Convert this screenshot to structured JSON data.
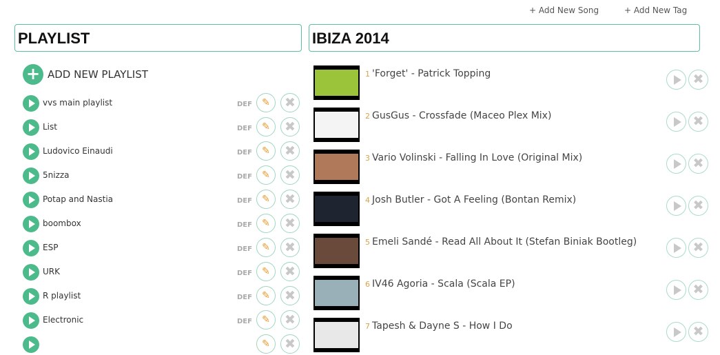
{
  "header": {
    "add_song": "+ Add New Song",
    "add_tag": "+ Add New Tag"
  },
  "playlist_panel": {
    "title": "PLAYLIST",
    "add_label": "ADD NEW PLAYLIST",
    "add_icon": "+"
  },
  "playlists": [
    {
      "name": "vvs main playlist",
      "badge": "DEF"
    },
    {
      "name": "List",
      "badge": "DEF"
    },
    {
      "name": "Ludovico Einaudi",
      "badge": "DEF"
    },
    {
      "name": "5nizza",
      "badge": "DEF"
    },
    {
      "name": "Potap and Nastia",
      "badge": "DEF"
    },
    {
      "name": "boombox",
      "badge": "DEF"
    },
    {
      "name": "ESP",
      "badge": "DEF"
    },
    {
      "name": "URK",
      "badge": "DEF"
    },
    {
      "name": "R playlist",
      "badge": "DEF"
    },
    {
      "name": "Electronic",
      "badge": "DEF"
    },
    {
      "name": "",
      "badge": ""
    }
  ],
  "songs_panel": {
    "title": "IBIZA 2014"
  },
  "songs": [
    {
      "num": "1",
      "title": "'Forget' - Patrick Topping",
      "thumb_color": "#9bc43a"
    },
    {
      "num": "2",
      "title": "GusGus - Crossfade (Maceo Plex Mix)",
      "thumb_color": "#f4f4f4"
    },
    {
      "num": "3",
      "title": "Vario Volinski - Falling In Love (Original Mix)",
      "thumb_color": "#b07a5a"
    },
    {
      "num": "4",
      "title": "Josh Butler - Got A Feeling (Bontan Remix)",
      "thumb_color": "#1e2430"
    },
    {
      "num": "5",
      "title": "Emeli Sandé - Read All About It (Stefan Biniak Bootleg)",
      "thumb_color": "#6a4a3a"
    },
    {
      "num": "6",
      "title": "IV46 Agoria - Scala (Scala EP)",
      "thumb_color": "#9ab0b8"
    },
    {
      "num": "7",
      "title": "Tapesh & Dayne S - How I Do",
      "thumb_color": "#e8e8e8"
    }
  ],
  "icons": {
    "edit": "✎",
    "delete": "✖"
  },
  "colors": {
    "accent": "#4cba8a",
    "border": "#5bbfa0",
    "edit": "#e69b2d",
    "muted": "#c8c8c8"
  }
}
